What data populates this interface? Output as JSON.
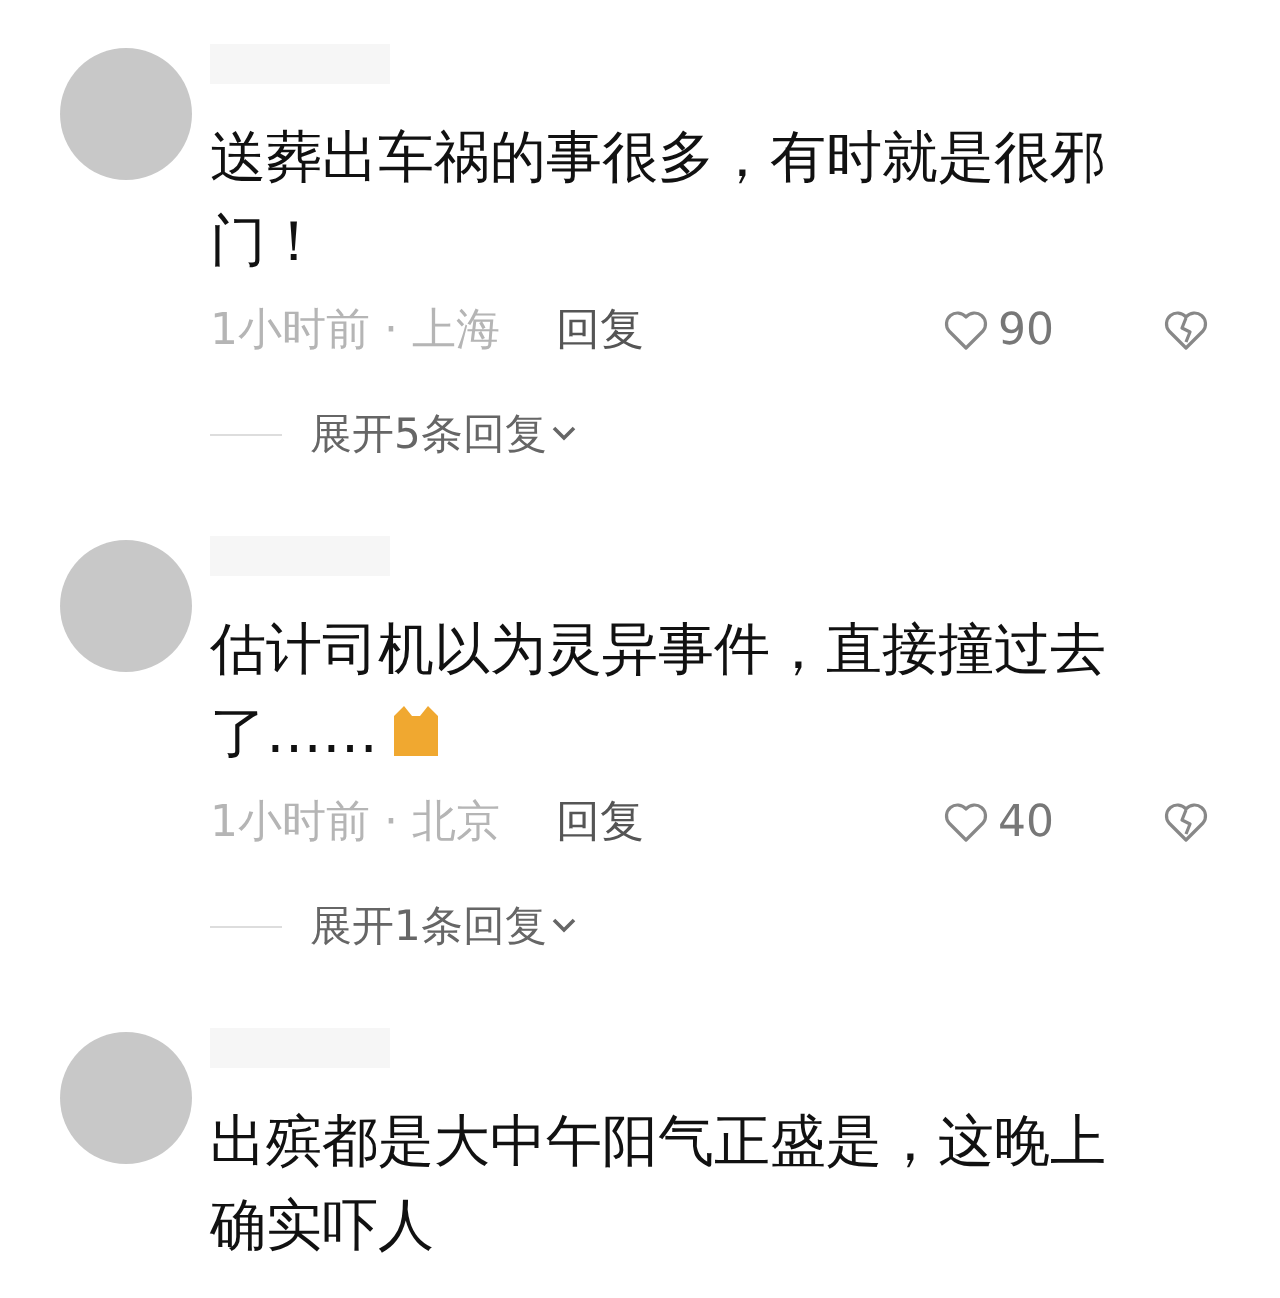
{
  "comments": [
    {
      "text": "送葬出车祸的事很多，有时就是很邪门！",
      "time": "1小时前 · 上海",
      "reply": "回复",
      "likes": "90",
      "expand": "展开5条回复"
    },
    {
      "text": "估计司机以为灵异事件，直接撞过去了……",
      "emoji": true,
      "time": "1小时前 · 北京",
      "reply": "回复",
      "likes": "40",
      "expand": "展开1条回复"
    },
    {
      "text": "出殡都是大中午阳气正盛是，这晚上确实吓人"
    }
  ]
}
